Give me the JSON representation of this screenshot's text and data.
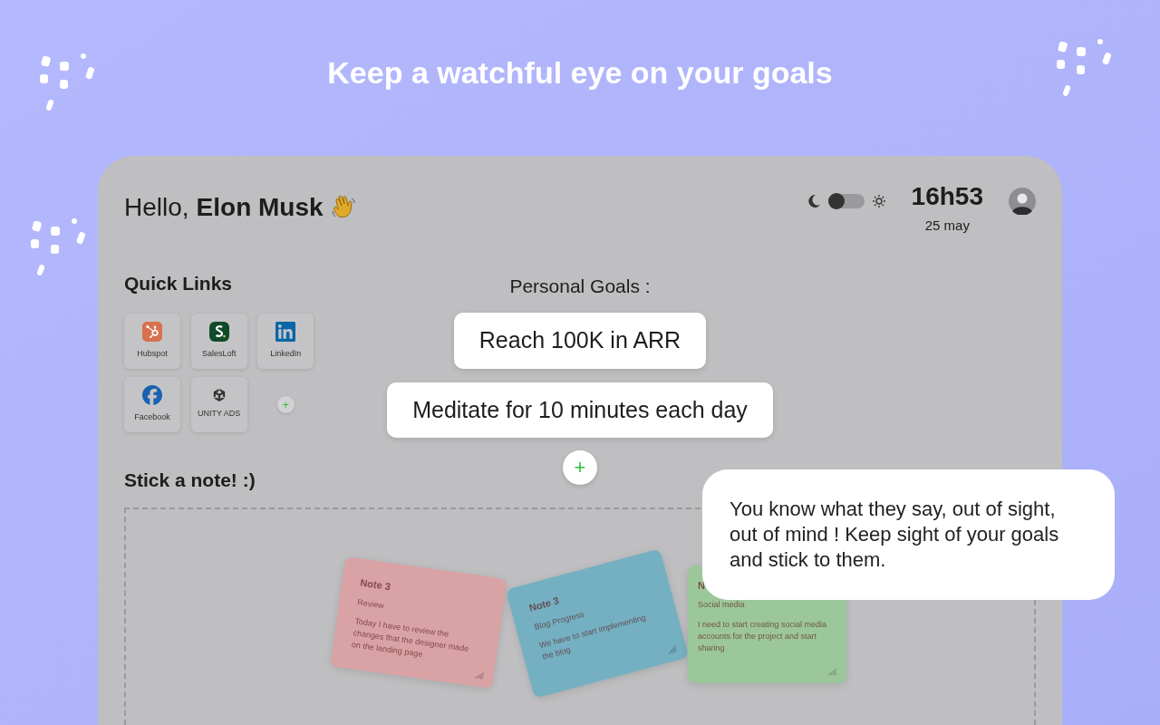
{
  "headline": "Keep a watchful eye on your goals",
  "header": {
    "greeting": "Hello,",
    "name": "Elon Musk",
    "theme_toggle": {
      "on": false
    },
    "time": "16h53",
    "date": "25 may"
  },
  "quick_links": {
    "title": "Quick Links",
    "links": [
      {
        "label": "Hubspot",
        "kind": "hubspot"
      },
      {
        "label": "SalesLoft",
        "kind": "salesloft"
      },
      {
        "label": "LinkedIn",
        "kind": "linkedin"
      },
      {
        "label": "Facebook",
        "kind": "facebook"
      },
      {
        "label": "UNITY ADS",
        "kind": "unity"
      }
    ],
    "add": "+"
  },
  "goals": {
    "title": "Personal Goals :",
    "items": [
      "Reach 100K in ARR",
      "Meditate for 10 minutes each day"
    ],
    "add": "+"
  },
  "notes": {
    "title": "Stick a note! :)",
    "items": [
      {
        "title": "Note 3",
        "subtitle": "Review",
        "body": "Today I have to review the changes that the designer made on the landing page",
        "color": "#d9a3a5"
      },
      {
        "title": "Note 3",
        "subtitle": "Blog Progress",
        "body": "We have to start implementing the blog",
        "color": "#74b0c2"
      },
      {
        "title": "N",
        "subtitle": "Social media",
        "body": "I need to start creating social media accounts for the project and start sharing",
        "color": "#9cc79a"
      }
    ]
  },
  "callout": "You know what they say, out of sight, out of mind ! Keep sight of your goals and stick to them."
}
